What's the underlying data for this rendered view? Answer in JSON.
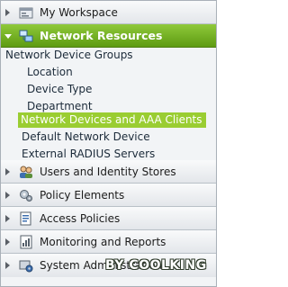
{
  "nav": {
    "workspace": {
      "label": "My Workspace",
      "icon": "workspace-icon"
    },
    "network_resources": {
      "label": "Network Resources",
      "icon": "network-resources-icon",
      "expanded": true,
      "children": {
        "ndg": "Network Device Groups",
        "location": "Location",
        "device_type": "Device Type",
        "department": "Department",
        "ndac": "Network Devices and AAA Clients",
        "default_device": "Default Network Device",
        "radius": "External RADIUS Servers"
      }
    },
    "users": {
      "label": "Users and Identity Stores",
      "icon": "users-icon"
    },
    "policy_elements": {
      "label": "Policy Elements",
      "icon": "policy-elements-icon"
    },
    "access_policies": {
      "label": "Access Policies",
      "icon": "access-policies-icon"
    },
    "monitoring": {
      "label": "Monitoring and Reports",
      "icon": "monitoring-icon"
    },
    "sysadmin": {
      "label": "System Administration",
      "icon": "system-administration-icon"
    }
  },
  "colors": {
    "active_header": "#6aa820",
    "selected_item": "#9acd32"
  },
  "watermark": "BY COOLKING"
}
